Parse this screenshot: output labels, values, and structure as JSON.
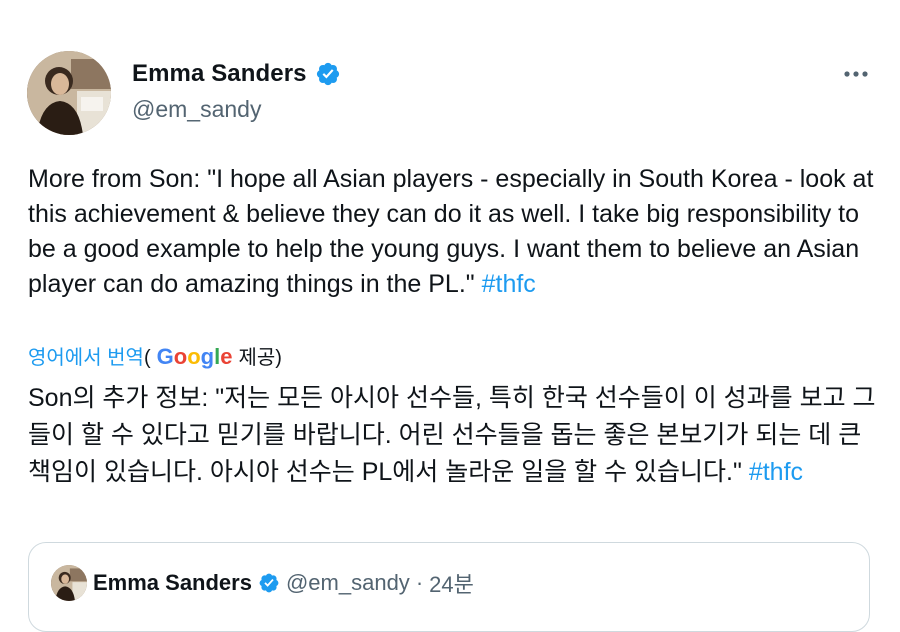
{
  "author": {
    "name": "Emma Sanders",
    "handle": "@em_sandy",
    "verified": true,
    "avatar_icon": "profile-photo"
  },
  "more_icon": "more-horizontal-icon",
  "tweet": {
    "text": "More from Son: \"I hope all Asian players - especially in South Korea - look at this achievement & believe they can do it as well. I take big responsibility to be a good example to help the young guys. I want them to believe an Asian player can do amazing things in the PL.\"",
    "hashtag": "#thfc"
  },
  "translation": {
    "link_label": "영어에서 번역",
    "open_paren": "(",
    "provider": "Google",
    "provided_label": "제공)",
    "text": "Son의 추가 정보: \"저는 모든 아시아 선수들, 특히 한국 선수들이 이 성과를 보고 그들이 할 수 있다고 믿기를 바랍니다. 어린 선수들을 돕는 좋은 본보기가 되는 데 큰 책임이 있습니다. 아시아 선수는 PL에서 놀라운 일을 할 수 있습니다.\"",
    "hashtag": "#thfc"
  },
  "quoted_tweet": {
    "name": "Emma Sanders",
    "handle": "@em_sandy",
    "separator": "·",
    "time": "24분"
  },
  "colors": {
    "link": "#1d9bf0",
    "text": "#0f1419",
    "secondary": "#536471",
    "verified_badge": "#1d9bf0",
    "border": "#cfd9de"
  }
}
